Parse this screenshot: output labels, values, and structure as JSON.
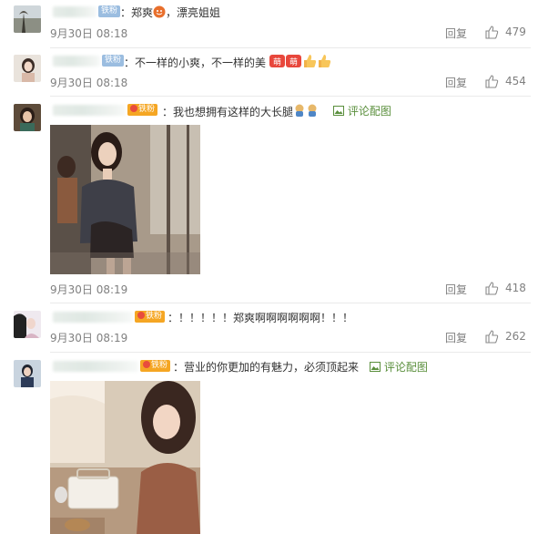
{
  "comments": [
    {
      "badge": "铁粉",
      "text_before": "：郑爽",
      "text_after": "，漂亮姐姐",
      "time": "9月30日 08:18",
      "reply": "回复",
      "likes": "479"
    },
    {
      "badge": "铁粉",
      "text": "：不一样的小爽，不一样的美",
      "sticker": "萌",
      "time": "9月30日 08:18",
      "reply": "回复",
      "likes": "454"
    },
    {
      "badge": "铁粉",
      "text": "：我也想拥有这样的大长腿",
      "link": "评论配图",
      "time": "9月30日 08:19",
      "reply": "回复",
      "likes": "418"
    },
    {
      "badge": "铁粉",
      "text": "：！！！！！郑爽啊啊啊啊啊啊！！！",
      "time": "9月30日 08:19",
      "reply": "回复",
      "likes": "262"
    },
    {
      "badge": "铁粉",
      "text": "：营业的你更加的有魅力，必须顶起来",
      "link": "评论配图"
    }
  ],
  "colors": {
    "link": "#5a8f3c",
    "meta": "#808080",
    "badge_blue": "#9bbde0",
    "badge_orange": "#f5a623"
  }
}
